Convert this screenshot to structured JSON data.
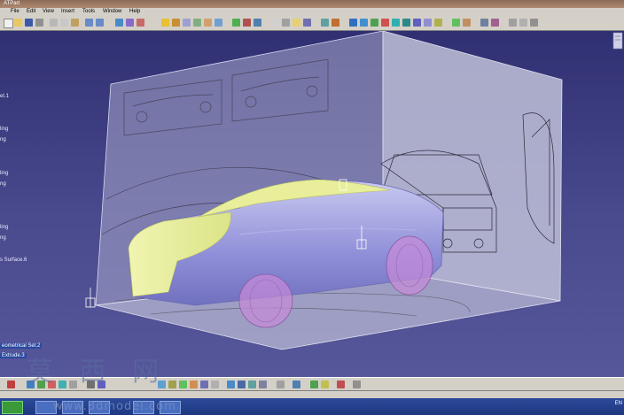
{
  "window": {
    "title": "ATPart"
  },
  "menu": {
    "items": [
      "File",
      "Edit",
      "View",
      "Insert",
      "Tools",
      "Window",
      "Help"
    ]
  },
  "tree": {
    "items": [
      {
        "label": "et.1",
        "selected": false
      },
      {
        "label": "ling",
        "selected": false
      },
      {
        "label": "ng",
        "selected": false
      },
      {
        "label": "ling",
        "selected": false
      },
      {
        "label": "ng",
        "selected": false
      },
      {
        "label": "ling",
        "selected": false
      },
      {
        "label": "ng",
        "selected": false
      },
      {
        "label": "s Surface.6",
        "selected": false
      },
      {
        "label": "eometrical Set.2",
        "selected": true
      },
      {
        "label": "Extrude.3",
        "selected": true
      }
    ]
  },
  "status": {
    "language": "EN"
  },
  "watermark": {
    "chars": "莫 西 网",
    "url": "www.3dmodel.com"
  },
  "colors": {
    "viewport": "#3a3a7a",
    "toolbar": "#d4d0c8",
    "car_body": "#9999dd",
    "car_front": "#e8ee9a"
  },
  "icons": [
    "sketch-icon",
    "pad-icon",
    "surface-icon",
    "zoom-icon",
    "rotate-icon",
    "pan-icon",
    "compass-icon"
  ]
}
